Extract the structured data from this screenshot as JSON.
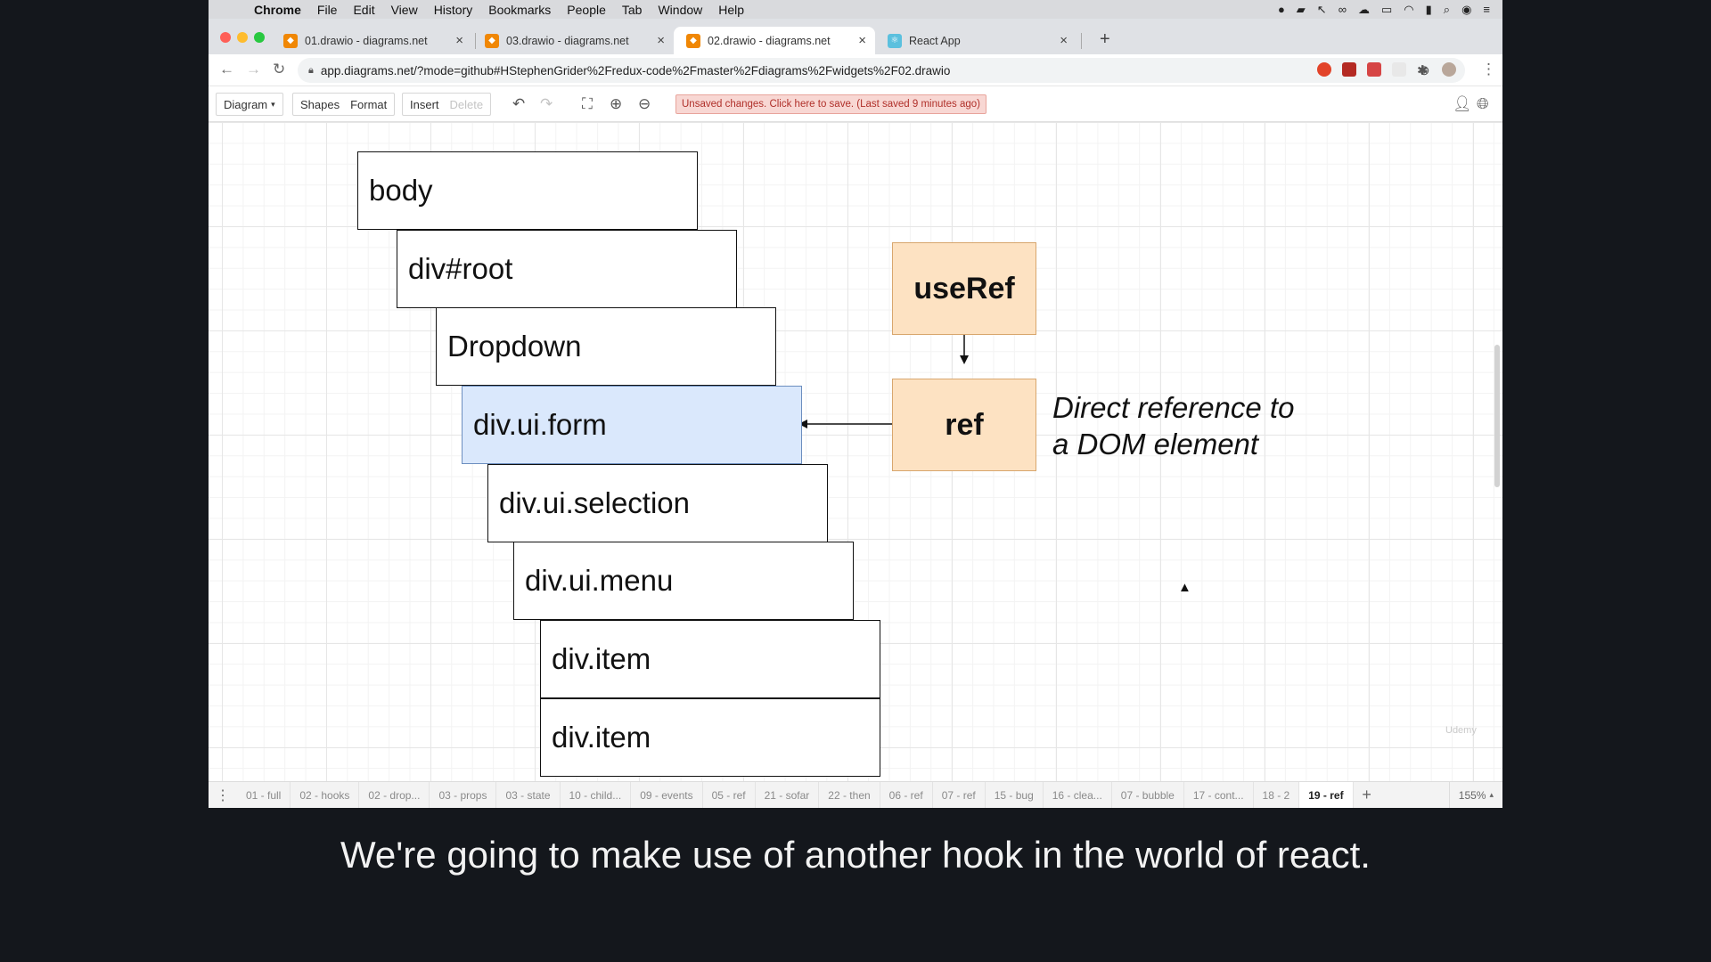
{
  "menubar": {
    "app": "Chrome",
    "items": [
      "File",
      "Edit",
      "View",
      "History",
      "Bookmarks",
      "People",
      "Tab",
      "Window",
      "Help"
    ]
  },
  "browser": {
    "tabs": [
      {
        "title": "01.drawio - diagrams.net",
        "active": false
      },
      {
        "title": "03.drawio - diagrams.net",
        "active": false
      },
      {
        "title": "02.drawio - diagrams.net",
        "active": true
      },
      {
        "title": "React App",
        "active": false
      }
    ],
    "url": "app.diagrams.net/?mode=github#HStephenGrider%2Fredux-code%2Fmaster%2Fdiagrams%2Fwidgets%2F02.drawio"
  },
  "toolbar": {
    "diagram": "Diagram",
    "shapes": "Shapes",
    "format": "Format",
    "insert": "Insert",
    "delete": "Delete",
    "unsaved": "Unsaved changes. Click here to save. (Last saved 9 minutes ago)"
  },
  "diagram": {
    "nodes": [
      "body",
      "div#root",
      "Dropdown",
      "div.ui.form",
      "div.ui.selection",
      "div.ui.menu",
      "div.item",
      "div.item"
    ],
    "selected_node": "div.ui.form",
    "use_ref": "useRef",
    "ref": "ref",
    "annotation": "Direct reference to\na DOM element",
    "watermark": "Udemy"
  },
  "pages": {
    "tabs": [
      "01 - full",
      "02 - hooks",
      "02 - drop...",
      "03 - props",
      "03 - state",
      "10 - child...",
      "09 - events",
      "05 - ref",
      "21 - sofar",
      "22 - then",
      "06 - ref",
      "07 - ref",
      "15 - bug",
      "16 - clea...",
      "07 - bubble",
      "17 - cont...",
      "18 - 2",
      "19 - ref"
    ],
    "active": "19 - ref",
    "zoom": "155%"
  },
  "subtitle": "We're going to make use of another hook in the world of react.",
  "colors": {
    "selected_fill": "#dae8fc",
    "selected_stroke": "#6c8ebf",
    "orange_fill": "#fde2c2",
    "orange_stroke": "#d8a66d",
    "unsaved_bg": "#f8d7d3"
  },
  "icons": [
    "apple-icon",
    "back-icon",
    "forward-icon",
    "reload-icon",
    "lock-icon",
    "star-icon",
    "undo-icon",
    "redo-icon",
    "fullscreen-icon",
    "zoom-in-icon",
    "zoom-out-icon",
    "user-icon",
    "globe-icon",
    "mouse-cursor-icon"
  ]
}
